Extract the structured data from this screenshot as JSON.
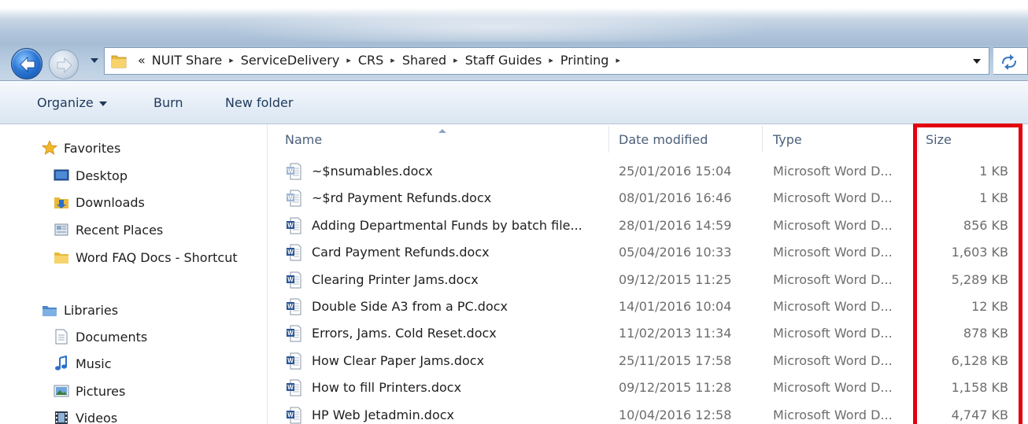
{
  "address_bar": {
    "overflow_marker": "«",
    "crumbs": [
      "NUIT Share",
      "ServiceDelivery",
      "CRS",
      "Shared",
      "Staff Guides",
      "Printing"
    ],
    "separator": "▸"
  },
  "toolbar": {
    "organize_label": "Organize",
    "burn_label": "Burn",
    "new_folder_label": "New folder"
  },
  "nav": {
    "favorites_label": "Favorites",
    "favorites_items": [
      "Desktop",
      "Downloads",
      "Recent Places",
      "Word FAQ Docs - Shortcut"
    ],
    "libraries_label": "Libraries",
    "libraries_items": [
      "Documents",
      "Music",
      "Pictures",
      "Videos"
    ]
  },
  "columns": {
    "name": "Name",
    "date_modified": "Date modified",
    "type": "Type",
    "size": "Size",
    "sorted_by": "Name"
  },
  "files": [
    {
      "name": "~$nsumables.docx",
      "date": "25/01/2016 15:04",
      "type": "Microsoft Word D...",
      "size": "1 KB",
      "temp": true
    },
    {
      "name": "~$rd Payment Refunds.docx",
      "date": "08/01/2016 16:46",
      "type": "Microsoft Word D...",
      "size": "1 KB",
      "temp": true
    },
    {
      "name": "Adding Departmental Funds by batch file...",
      "date": "28/01/2016 14:59",
      "type": "Microsoft Word D...",
      "size": "856 KB",
      "temp": false
    },
    {
      "name": "Card Payment Refunds.docx",
      "date": "05/04/2016 10:33",
      "type": "Microsoft Word D...",
      "size": "1,603 KB",
      "temp": false
    },
    {
      "name": "Clearing Printer Jams.docx",
      "date": "09/12/2015 11:25",
      "type": "Microsoft Word D...",
      "size": "5,289 KB",
      "temp": false
    },
    {
      "name": "Double Side A3 from a PC.docx",
      "date": "14/01/2016 10:04",
      "type": "Microsoft Word D...",
      "size": "12 KB",
      "temp": false
    },
    {
      "name": "Errors, Jams. Cold Reset.docx",
      "date": "11/02/2013 11:34",
      "type": "Microsoft Word D...",
      "size": "878 KB",
      "temp": false
    },
    {
      "name": "How Clear Paper Jams.docx",
      "date": "25/11/2015 17:58",
      "type": "Microsoft Word D...",
      "size": "6,128 KB",
      "temp": false
    },
    {
      "name": "How to fill Printers.docx",
      "date": "09/12/2015 11:28",
      "type": "Microsoft Word D...",
      "size": "1,158 KB",
      "temp": false
    },
    {
      "name": "HP Web Jetadmin.docx",
      "date": "10/04/2016 12:58",
      "type": "Microsoft Word D...",
      "size": "4,747 KB",
      "temp": false
    }
  ],
  "colors": {
    "highlight_box": "#e3000f",
    "word_icon_blue": "#2b5797"
  }
}
